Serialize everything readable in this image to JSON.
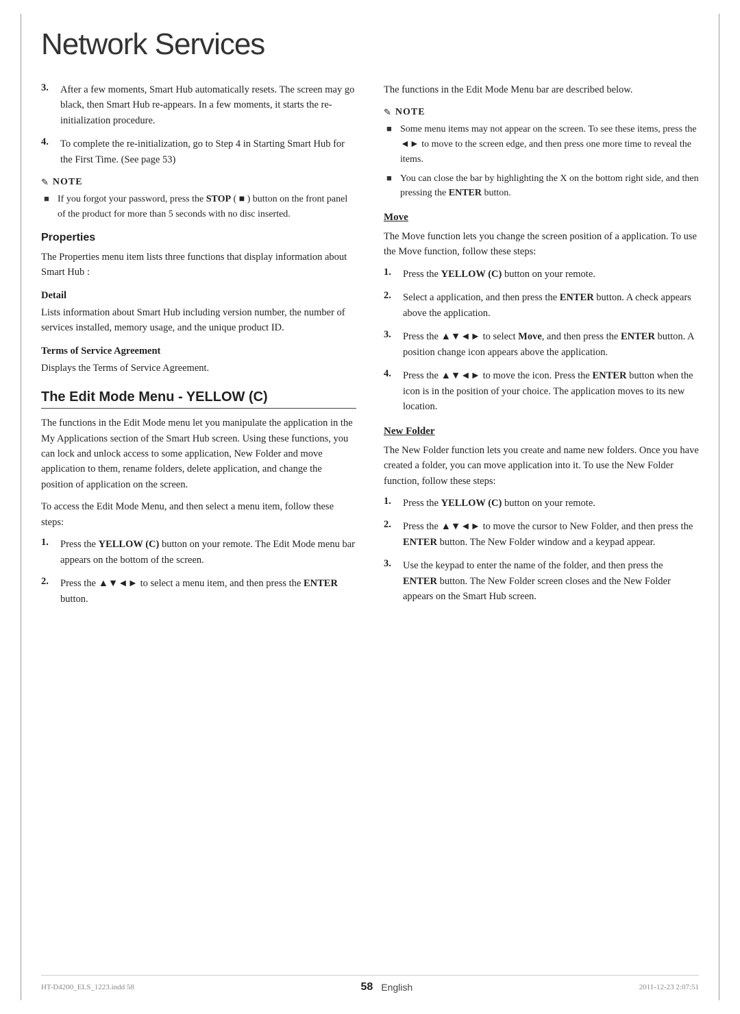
{
  "page": {
    "title": "Network Services",
    "page_number": "58",
    "language": "English",
    "footer_file": "HT-D4200_ELS_1223.indd  58",
    "footer_date": "2011-12-23   2:07:51"
  },
  "left_column": {
    "step3": {
      "num": "3.",
      "text": "After a few moments, Smart Hub automatically resets. The screen may go black, then Smart Hub re-appears. In a few moments, it starts the re-initialization procedure."
    },
    "step4": {
      "num": "4.",
      "text": "To complete the re-initialization, go to Step 4 in Starting Smart Hub for the First Time. (See page 53)"
    },
    "note": {
      "label": "NOTE",
      "items": [
        "If you forgot your password, press the STOP ( ■ ) button on the front panel of the product for more than 5 seconds with no disc inserted."
      ]
    },
    "properties": {
      "heading": "Properties",
      "intro": "The Properties menu item lists three functions that display information about Smart Hub :",
      "detail": {
        "heading": "Detail",
        "text": "Lists information about Smart Hub including version number, the number of services installed, memory usage, and the unique product ID."
      },
      "terms": {
        "heading": "Terms of Service Agreement",
        "text": "Displays the Terms of Service Agreement."
      }
    },
    "edit_mode_menu": {
      "heading": "The Edit Mode Menu - YELLOW (C)",
      "intro": "The functions in the Edit Mode menu let you manipulate the application in the My Applications section of the Smart Hub screen. Using these functions, you can lock and unlock access to some application, New Folder and move application to them, rename folders, delete application, and change the position of application on the screen.",
      "access_text": "To access the Edit Mode Menu, and then select a menu item, follow these steps:",
      "steps": [
        {
          "num": "1.",
          "text": "Press the YELLOW (C) button on your remote. The Edit Mode menu bar appears on the bottom of the screen."
        },
        {
          "num": "2.",
          "text": "Press the ▲▼◄► to select a menu item, and then press the ENTER button."
        }
      ]
    }
  },
  "right_column": {
    "functions_intro": "The functions in the Edit Mode Menu bar are described below.",
    "note": {
      "label": "NOTE",
      "items": [
        "Some menu items may not appear on the screen. To see these items, press the ◄► to move to the screen edge, and then press one more time to reveal the items.",
        "You can close the bar by highlighting the X on the bottom right side, and then pressing the ENTER button."
      ]
    },
    "move": {
      "heading": "Move",
      "intro": "The Move function lets you change the screen position of a application. To use the Move function, follow these steps:",
      "steps": [
        {
          "num": "1.",
          "text": "Press the YELLOW (C) button on your remote."
        },
        {
          "num": "2.",
          "text": "Select a application, and then press the ENTER button. A check appears above the application."
        },
        {
          "num": "3.",
          "text": "Press the ▲▼◄► to select Move, and then press the ENTER button. A position change icon appears above the application."
        },
        {
          "num": "4.",
          "text": "Press the ▲▼◄► to move the icon. Press the ENTER button when the icon is in the position of your choice. The application moves to its new location."
        }
      ]
    },
    "new_folder": {
      "heading": "New Folder",
      "intro": "The New Folder function lets you create and name new folders. Once you have created a folder, you can move application into it. To use the New Folder function, follow these steps:",
      "steps": [
        {
          "num": "1.",
          "text": "Press the YELLOW (C) button on your remote."
        },
        {
          "num": "2.",
          "text": "Press the ▲▼◄► to move the cursor to New Folder, and then press the ENTER button. The New Folder window and a keypad appear."
        },
        {
          "num": "3.",
          "text": "Use the keypad to enter the name of the folder, and then press the ENTER button. The New Folder screen closes and the New Folder appears on the Smart Hub screen."
        }
      ]
    }
  }
}
